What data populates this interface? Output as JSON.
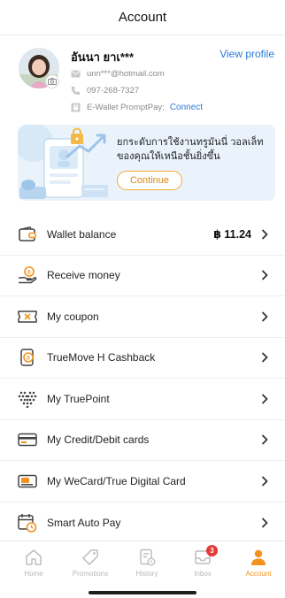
{
  "header": {
    "title": "Account"
  },
  "profile": {
    "name": "อันนา ยาเ***",
    "view_profile": "View profile",
    "email": "unn***@hotmail.com",
    "phone": "097-268-7327",
    "promptpay_label": "E-Wallet PromptPay:",
    "promptpay_link": "Connect"
  },
  "banner": {
    "text": "ยกระดับการใช้งานทรูมันนี่ วอลเล็ทของคุณให้เหนือชั้นยิ่งขึ้น",
    "button": "Continue"
  },
  "menu": {
    "items": [
      {
        "label": "Wallet balance",
        "value": "฿ 11.24",
        "icon": "wallet-icon"
      },
      {
        "label": "Receive money",
        "icon": "receive-money-icon"
      },
      {
        "label": "My coupon",
        "icon": "coupon-icon"
      },
      {
        "label": "TrueMove H Cashback",
        "icon": "cashback-icon"
      },
      {
        "label": "My TruePoint",
        "icon": "truepoint-icon"
      },
      {
        "label": "My Credit/Debit cards",
        "icon": "credit-card-icon"
      },
      {
        "label": "My WeCard/True Digital Card",
        "icon": "wecard-icon"
      },
      {
        "label": "Smart Auto Pay",
        "icon": "calendar-clock-icon"
      }
    ]
  },
  "tabbar": {
    "tabs": [
      {
        "label": "Home",
        "icon": "home-icon"
      },
      {
        "label": "Promotions",
        "icon": "tag-icon"
      },
      {
        "label": "History",
        "icon": "history-icon"
      },
      {
        "label": "Inbox",
        "icon": "inbox-icon",
        "badge": "3"
      },
      {
        "label": "Account",
        "icon": "person-icon",
        "active": true
      }
    ]
  },
  "colors": {
    "accent": "#f2931f",
    "link": "#2a7bd8",
    "badge": "#e53935"
  }
}
